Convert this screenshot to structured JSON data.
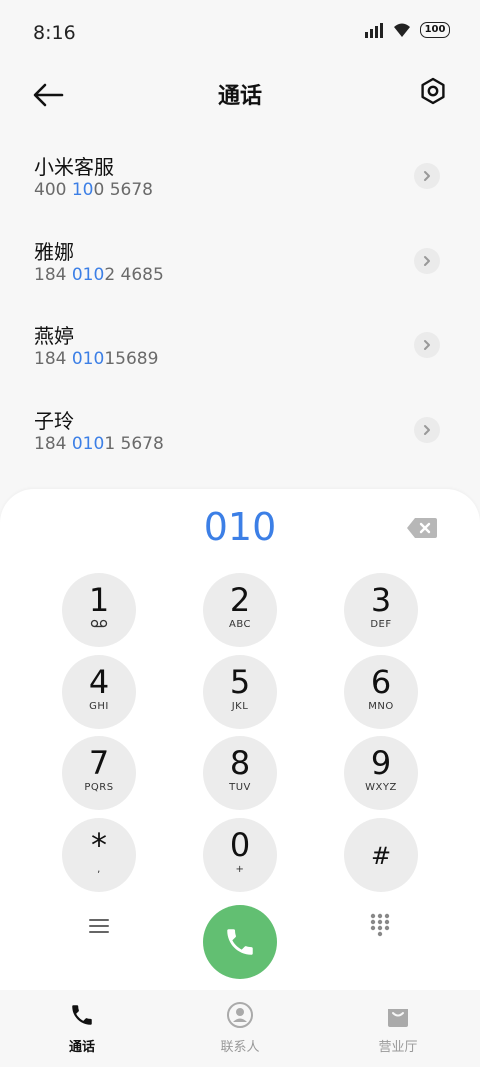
{
  "status": {
    "time": "8:16",
    "battery": "100"
  },
  "appbar": {
    "title": "通话"
  },
  "contacts": [
    {
      "name": "小米客服",
      "num": [
        "400 ",
        "10",
        "0 5678"
      ]
    },
    {
      "name": "雅娜",
      "num": [
        "184 ",
        "010",
        "2 4685"
      ]
    },
    {
      "name": "燕婷",
      "num": [
        "184 ",
        "010",
        "15689"
      ]
    },
    {
      "name": "子玲",
      "num": [
        "184 ",
        "010",
        "1 5678"
      ]
    }
  ],
  "dialer": {
    "input": "010",
    "keys": [
      {
        "digit": "1",
        "letters": "voicemail-icon"
      },
      {
        "digit": "2",
        "letters": "ABC"
      },
      {
        "digit": "3",
        "letters": "DEF"
      },
      {
        "digit": "4",
        "letters": "GHI"
      },
      {
        "digit": "5",
        "letters": "JKL"
      },
      {
        "digit": "6",
        "letters": "MNO"
      },
      {
        "digit": "7",
        "letters": "PQRS"
      },
      {
        "digit": "8",
        "letters": "TUV"
      },
      {
        "digit": "9",
        "letters": "WXYZ"
      },
      {
        "digit": "*",
        "letters": ","
      },
      {
        "digit": "0",
        "letters": "+"
      },
      {
        "digit": "#",
        "letters": ""
      }
    ]
  },
  "nav": {
    "calls": "通话",
    "contacts": "联系人",
    "store": "营业厅"
  },
  "colors": {
    "accent": "#3c7fe6",
    "call": "#62bf72"
  }
}
